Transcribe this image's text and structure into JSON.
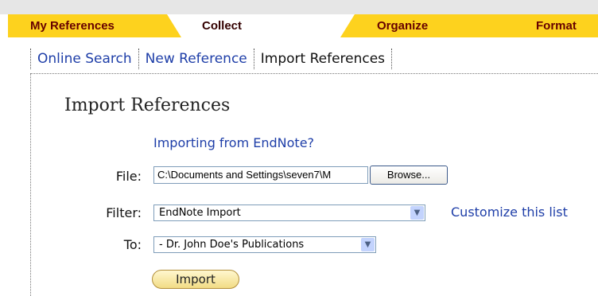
{
  "tabs": {
    "my_references": "My References",
    "collect": "Collect",
    "organize": "Organize",
    "format": "Format"
  },
  "subnav": {
    "online_search": "Online Search",
    "new_reference": "New Reference",
    "import_references": "Import References"
  },
  "page": {
    "title": "Import References",
    "endnote_link": "Importing from EndNote?"
  },
  "form": {
    "file_label": "File:",
    "file_value": "C:\\Documents and Settings\\seven7\\M",
    "browse_label": "Browse...",
    "filter_label": "Filter:",
    "filter_value": "EndNote Import",
    "customize_link": "Customize this list",
    "to_label": "To:",
    "to_value": "- Dr. John Doe's Publications",
    "import_label": "Import"
  },
  "colors": {
    "tab_yellow": "#fdd21e",
    "tab_text": "#660000",
    "link_blue": "#1e3ea8"
  }
}
